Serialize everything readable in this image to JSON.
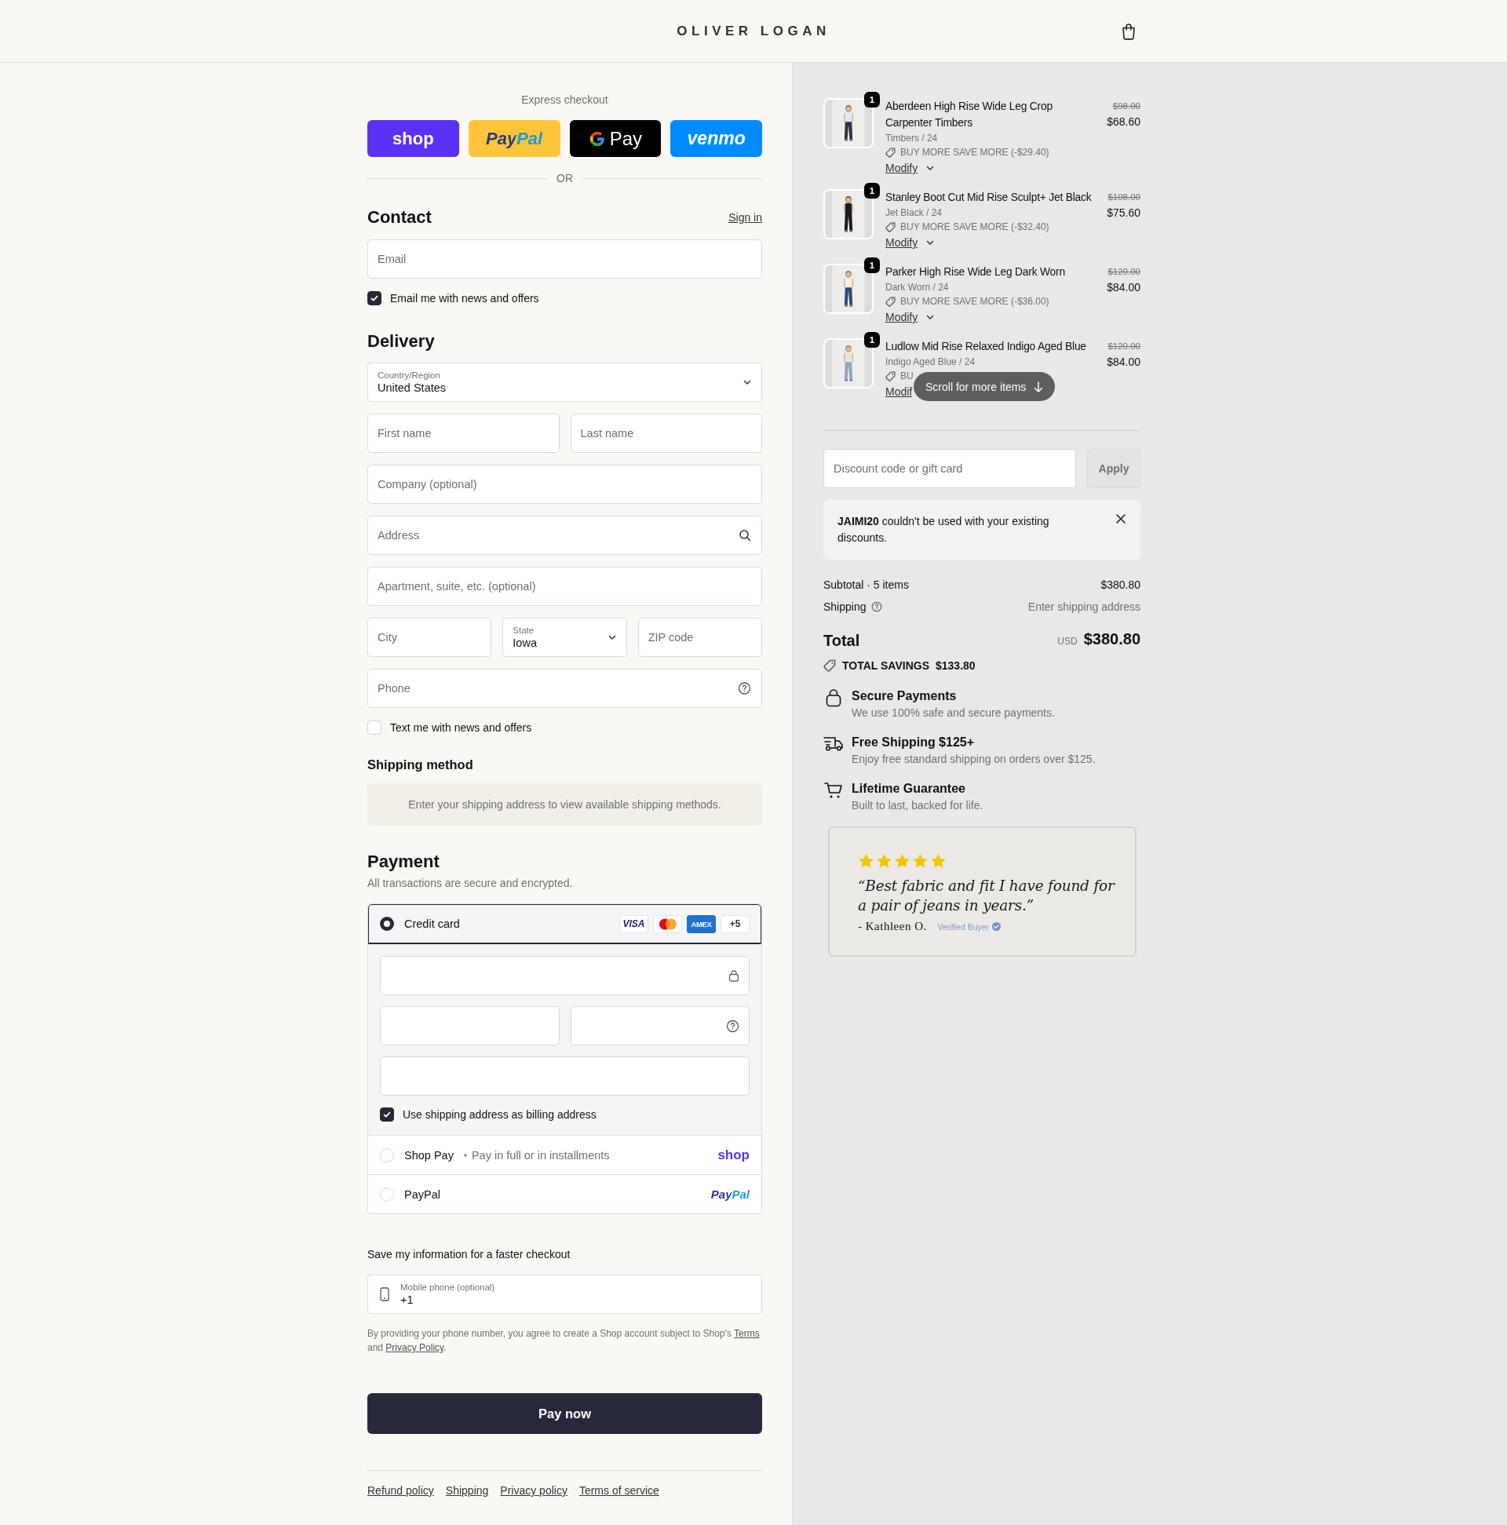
{
  "header": {
    "logo": "OLIVER LOGAN"
  },
  "express": {
    "title": "Express checkout",
    "buttons": [
      {
        "kind": "shop",
        "label": "shop"
      },
      {
        "kind": "paypal",
        "label": "PayPal"
      },
      {
        "kind": "gpay",
        "label": "Pay"
      },
      {
        "kind": "venmo",
        "label": "venmo"
      }
    ],
    "divider": "OR"
  },
  "contact": {
    "title": "Contact",
    "sign_in": "Sign in",
    "email": {
      "kind": "text",
      "placeholder": "Email"
    },
    "news": {
      "label": "Email me with news and offers",
      "checked": true
    }
  },
  "delivery": {
    "title": "Delivery",
    "rows": [
      [
        {
          "kind": "select",
          "label": "Country/Region",
          "value": "United States"
        }
      ],
      [
        {
          "kind": "text",
          "placeholder": "First name"
        },
        {
          "kind": "text",
          "placeholder": "Last name"
        }
      ],
      [
        {
          "kind": "text",
          "placeholder": "Company (optional)"
        }
      ],
      [
        {
          "kind": "search",
          "placeholder": "Address"
        }
      ],
      [
        {
          "kind": "text",
          "placeholder": "Apartment, suite, etc. (optional)"
        }
      ],
      [
        {
          "kind": "text",
          "placeholder": "City"
        },
        {
          "kind": "select",
          "label": "State",
          "value": "Iowa"
        },
        {
          "kind": "text",
          "placeholder": "ZIP code"
        }
      ],
      [
        {
          "kind": "help",
          "placeholder": "Phone"
        }
      ]
    ],
    "sms": {
      "label": "Text me with news and offers",
      "checked": false
    }
  },
  "shipping_method": {
    "title": "Shipping method",
    "message": "Enter your shipping address to view available shipping methods."
  },
  "payment": {
    "title": "Payment",
    "subtitle": "All transactions are secure and encrypted.",
    "methods": [
      {
        "kind": "card",
        "label": "Credit card",
        "selected": true,
        "brands": [
          {
            "kind": "visa",
            "label": "VISA"
          },
          {
            "kind": "mastercard"
          },
          {
            "kind": "amex",
            "label": "AMEX"
          },
          {
            "kind": "more",
            "label": "+5"
          }
        ],
        "fields": [
          [
            {
              "kind": "secure"
            }
          ],
          [
            {
              "kind": "plain"
            },
            {
              "kind": "help"
            }
          ],
          [
            {
              "kind": "plain"
            }
          ]
        ],
        "billing": {
          "label": "Use shipping address as billing address",
          "checked": true
        }
      },
      {
        "kind": "shoppay",
        "label": "Shop Pay",
        "note": "Pay in full or in installments",
        "logo": "shop",
        "selected": false
      },
      {
        "kind": "paypal",
        "label": "PayPal",
        "logo": "PayPal",
        "selected": false
      }
    ]
  },
  "save_info": {
    "title": "Save my information for a faster checkout",
    "phone": {
      "label": "Mobile phone (optional)",
      "value": "+1"
    },
    "legal": [
      {
        "kind": "text",
        "text": "By providing your phone number, you agree to create a Shop account subject to Shop's "
      },
      {
        "kind": "link",
        "text": "Terms"
      },
      {
        "kind": "text",
        "text": " and "
      },
      {
        "kind": "link",
        "text": "Privacy Policy"
      },
      {
        "kind": "text",
        "text": "."
      }
    ]
  },
  "pay_button": "Pay now",
  "footer_links": [
    "Refund policy",
    "Shipping",
    "Privacy policy",
    "Terms of service"
  ],
  "items": [
    {
      "quantity": "1",
      "title": "Aberdeen High Rise Wide Leg Crop Carpenter Timbers",
      "variant": "Timbers / 24",
      "discount": "BUY MORE SAVE MORE (-$29.40)",
      "modify": "Modify",
      "menu": true,
      "original_price": "$98.00",
      "price": "$68.60"
    },
    {
      "quantity": "1",
      "title": "Stanley Boot Cut Mid Rise Sculpt+ Jet Black",
      "variant": "Jet Black / 24",
      "discount": "BUY MORE SAVE MORE (-$32.40)",
      "modify": "Modify",
      "menu": true,
      "original_price": "$108.00",
      "price": "$75.60"
    },
    {
      "quantity": "1",
      "title": "Parker High Rise Wide Leg Dark Worn",
      "variant": "Dark Worn / 24",
      "discount": "BUY MORE SAVE MORE (-$36.00)",
      "modify": "Modify",
      "menu": true,
      "original_price": "$120.00",
      "price": "$84.00"
    },
    {
      "quantity": "1",
      "title": "Ludlow Mid Rise Relaxed Indigo Aged Blue",
      "variant": "Indigo Aged Blue / 24",
      "discount": "BU",
      "modify": "Modif",
      "menu": false,
      "original_price": "$120.00",
      "price": "$84.00"
    }
  ],
  "scroll_hint": "Scroll for more items",
  "discount": {
    "placeholder": "Discount code or gift card",
    "apply": {
      "label": "Apply",
      "disabled": true
    }
  },
  "notice": {
    "text": "**JAIMI20** couldn't be used with your existing discounts."
  },
  "summary": {
    "rows": [
      {
        "kind": "plain",
        "label": "Subtotal · 5 items",
        "value": "$380.80"
      },
      {
        "kind": "shipping",
        "label": "Shipping",
        "value": "Enter shipping address"
      }
    ],
    "total": {
      "label": "Total",
      "currency": "USD",
      "amount": "$380.80"
    },
    "savings": {
      "label": "TOTAL SAVINGS",
      "amount": "$133.80"
    }
  },
  "features": [
    {
      "title": "Secure Payments",
      "text": "We use 100% safe and secure payments."
    },
    {
      "title": "Free Shipping $125+",
      "text": "Enjoy free standard shipping on orders over $125."
    },
    {
      "title": "Lifetime Guarantee",
      "text": "Built to last, backed for life."
    }
  ],
  "review": {
    "stars": 5,
    "quote": "“Best fabric and fit I have found for a pair of jeans in years.”",
    "author": "- Kathleen O.",
    "badge": "Verified Buyer"
  }
}
